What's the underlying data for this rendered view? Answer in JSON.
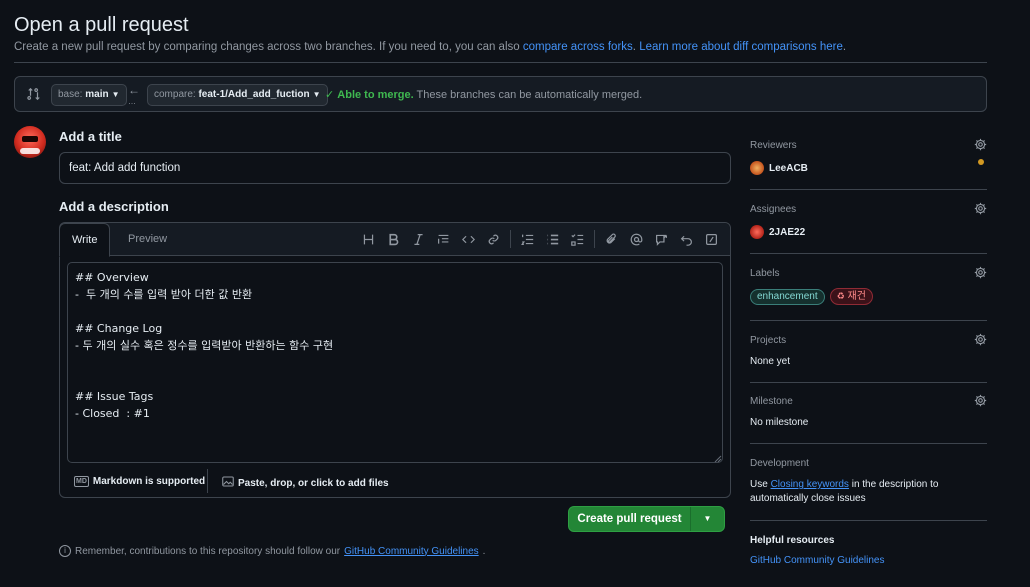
{
  "header": {
    "title": "Open a pull request",
    "subtitle_prefix": "Create a new pull request by comparing changes across two branches. If you need to, you can also ",
    "compare_forks_link": "compare across forks",
    "subtitle_mid": ". ",
    "learn_more_link": "Learn more about diff comparisons here",
    "subtitle_end": "."
  },
  "compare": {
    "base_prefix": "base:",
    "base_branch": "main",
    "compare_prefix": "compare:",
    "compare_branch": "feat-1/Add_add_fuction",
    "merge_ok": "Able to merge.",
    "merge_text": "These branches can be automatically merged."
  },
  "form": {
    "title_heading": "Add a title",
    "title_value": "feat: Add add function",
    "description_heading": "Add a description",
    "tab_write": "Write",
    "tab_preview": "Preview",
    "description_value": "## Overview\n-  두 개의 수를 입력 받아 더한 값 반환\n\n## Change Log\n- 두 개의 실수 혹은 정수를 입력받아 반환하는 함수 구현\n\n\n## Issue Tags\n- Closed  : #1",
    "markdown_note": "Markdown is supported",
    "markdown_badge": "MD",
    "attach_note": "Paste, drop, or click to add files",
    "toolbar_icons": [
      "heading-icon",
      "bold-icon",
      "italic-icon",
      "quote-icon",
      "code-icon",
      "link-icon",
      "numbered-list-icon",
      "unordered-list-icon",
      "task-list-icon",
      "attach-icon",
      "mention-icon",
      "reference-icon",
      "undo-icon",
      "slash-commands-icon"
    ]
  },
  "actions": {
    "create_pr": "Create pull request",
    "note_prefix": "Remember, contributions to this repository should follow our ",
    "note_link": "GitHub Community Guidelines",
    "note_suffix": "."
  },
  "sidebar": {
    "reviewers": {
      "title": "Reviewers",
      "user": "LeeACB"
    },
    "assignees": {
      "title": "Assignees",
      "user": "2JAE22"
    },
    "labels": {
      "title": "Labels",
      "items": [
        "enhancement",
        "재건"
      ]
    },
    "projects": {
      "title": "Projects",
      "value": "None yet"
    },
    "milestone": {
      "title": "Milestone",
      "value": "No milestone"
    },
    "development": {
      "title": "Development",
      "text_prefix": "Use ",
      "link": "Closing keywords",
      "text_suffix": " in the description to automatically close issues"
    },
    "help": {
      "title": "Helpful resources",
      "link": "GitHub Community Guidelines"
    }
  },
  "colors": {
    "background": "#0d1117",
    "accent_link": "#4493f8",
    "success": "#3fb950",
    "primary_button": "#238636",
    "pending_dot": "#d29922"
  }
}
